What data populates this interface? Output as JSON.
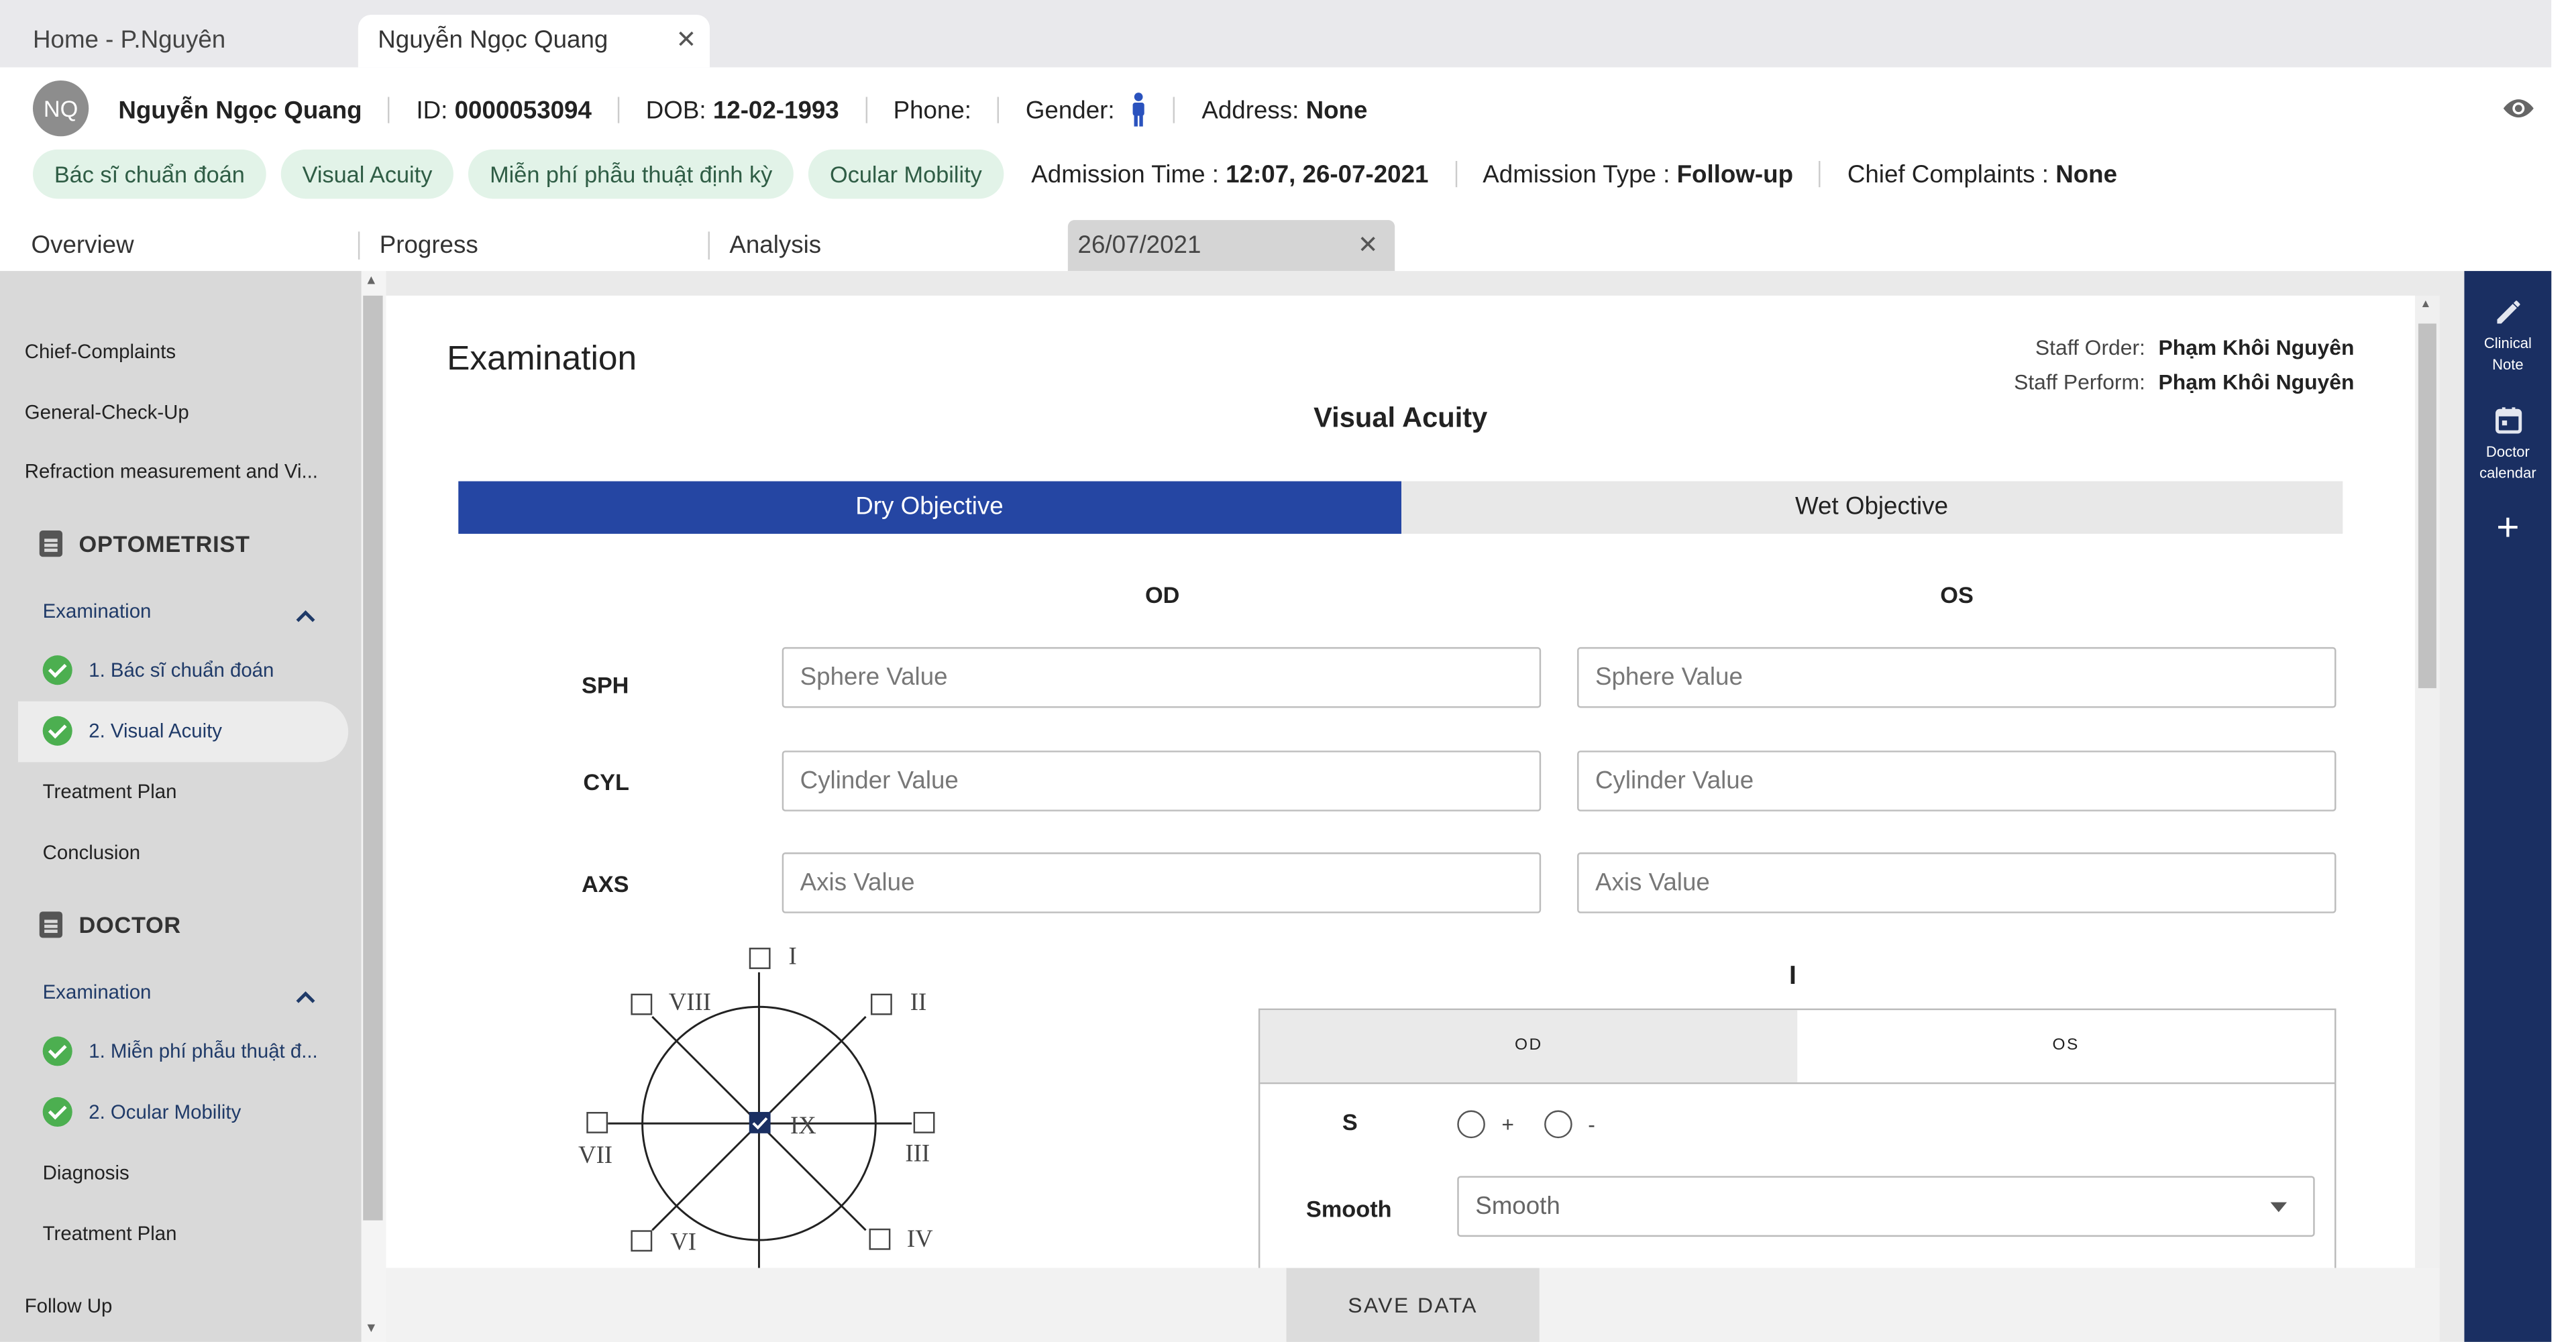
{
  "browser_tabs": [
    {
      "label": "Home - P.Nguyên"
    },
    {
      "label": "Nguyễn Ngọc Quang"
    }
  ],
  "patient": {
    "initials": "NQ",
    "name": "Nguyễn Ngọc Quang",
    "id_label": "ID:",
    "id_value": "0000053094",
    "dob_label": "DOB:",
    "dob_value": "12-02-1993",
    "phone_label": "Phone:",
    "gender_label": "Gender:",
    "address_label": "Address:",
    "address_value": "None"
  },
  "chips": [
    "Bác sĩ chuẩn đoán",
    "Visual Acuity",
    "Miễn phí phẫu thuật định kỳ",
    "Ocular Mobility"
  ],
  "admission": {
    "time_label": "Admission Time :",
    "time_value": "12:07, 26-07-2021",
    "type_label": "Admission Type :",
    "type_value": "Follow-up",
    "complaints_label": "Chief Complaints :",
    "complaints_value": "None"
  },
  "page_tabs": [
    "Overview",
    "Progress",
    "Analysis",
    "26/07/2021"
  ],
  "sidebar": {
    "top_items": [
      "Chief-Complaints",
      "General-Check-Up",
      "Refraction measurement and Vi..."
    ],
    "optometrist": {
      "title": "OPTOMETRIST",
      "group": "Examination",
      "checks": [
        "1. Bác sĩ chuẩn đoán",
        "2. Visual Acuity"
      ],
      "items": [
        "Treatment Plan",
        "Conclusion"
      ]
    },
    "doctor": {
      "title": "DOCTOR",
      "group": "Examination",
      "checks": [
        "1. Miễn phí phẫu thuật đ...",
        "2. Ocular Mobility"
      ],
      "items": [
        "Diagnosis",
        "Treatment Plan"
      ]
    },
    "bottom_item": "Follow Up"
  },
  "exam": {
    "title": "Examination",
    "staff_order_label": "Staff Order:",
    "staff_order_value": "Phạm Khôi Nguyên",
    "staff_perform_label": "Staff Perform:",
    "staff_perform_value": "Phạm Khôi Nguyên",
    "section_title": "Visual Acuity",
    "toggle": {
      "dry": "Dry Objective",
      "wet": "Wet Objective"
    },
    "col_od": "OD",
    "col_os": "OS",
    "rows": [
      {
        "label": "SPH",
        "placeholder": "Sphere Value"
      },
      {
        "label": "CYL",
        "placeholder": "Cylinder Value"
      },
      {
        "label": "AXS",
        "placeholder": "Axis Value"
      }
    ],
    "gaze": {
      "positions": [
        "I",
        "II",
        "III",
        "IV",
        "VI",
        "VII",
        "VIII",
        "IX"
      ],
      "checked": "IX"
    },
    "cursor_glyph": "I",
    "subtabs": {
      "od": "OD",
      "os": "OS"
    },
    "s_label": "S",
    "s_plus": "+",
    "s_minus": "-",
    "smooth_label": "Smooth",
    "smooth_value": "Smooth"
  },
  "save_label": "SAVE DATA",
  "rail": {
    "clinical_note": [
      "Clinical",
      "Note"
    ],
    "doctor_calendar": [
      "Doctor",
      "calendar"
    ],
    "add": "+"
  },
  "colors": {
    "accent": "#2546a3",
    "rail": "#1a2f62",
    "chip_bg": "#e2f3e8",
    "check": "#4caf50"
  }
}
